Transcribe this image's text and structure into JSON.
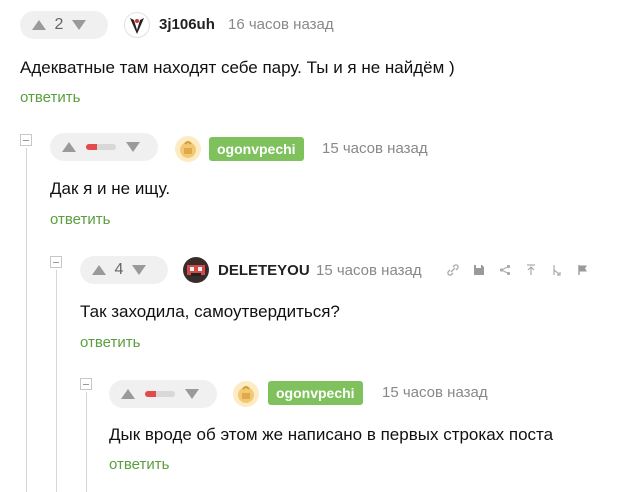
{
  "comments": [
    {
      "votes": "2",
      "username": "3j106uh",
      "time": "16 часов назад",
      "text": "Адекватные там находят себе пару. Ты и я не найдём )",
      "reply": "ответить"
    },
    {
      "vote_ratio": 0.35,
      "username": "ogonvpechi",
      "time": "15 часов назад",
      "text": "Дак я и не ищу.",
      "reply": "ответить"
    },
    {
      "votes": "4",
      "username": "DELETEYOU",
      "time": "15 часов назад",
      "text": "Так заходила, самоутвердиться?",
      "reply": "ответить",
      "tools": [
        "link-icon",
        "save-icon",
        "share-icon",
        "go-to-parent-icon",
        "branch-icon",
        "report-flag-icon"
      ]
    },
    {
      "vote_ratio": 0.35,
      "username": "ogonvpechi",
      "time": "15 часов назад",
      "text": "Дык вроде об этом же написано в первых строках поста",
      "reply": "ответить"
    }
  ],
  "colors": {
    "badge": "#7ec15d",
    "reply": "#5b9e3e",
    "downvote_fill": "#e34a4a"
  }
}
